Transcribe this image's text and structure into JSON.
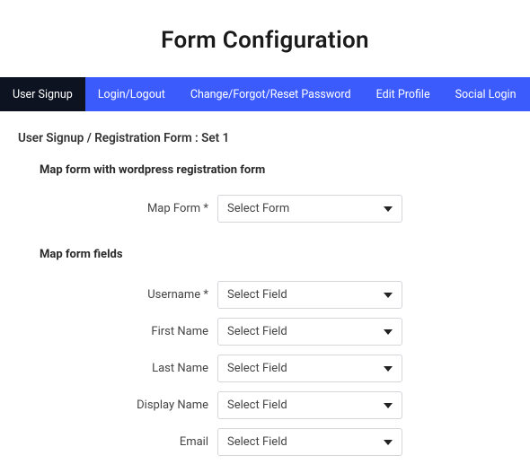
{
  "page_title": "Form Configuration",
  "tabs": [
    {
      "label": "User Signup",
      "active": true
    },
    {
      "label": "Login/Logout",
      "active": false
    },
    {
      "label": "Change/Forgot/Reset Password",
      "active": false
    },
    {
      "label": "Edit Profile",
      "active": false
    },
    {
      "label": "Social Login",
      "active": false
    }
  ],
  "panel": {
    "title": "User Signup / Registration Form : Set 1",
    "section_map_form": "Map form with wordpress registration form",
    "section_map_fields": "Map form fields",
    "map_form_label": "Map Form *",
    "map_form_value": "Select Form",
    "fields": [
      {
        "label": "Username *",
        "value": "Select Field"
      },
      {
        "label": "First Name",
        "value": "Select Field"
      },
      {
        "label": "Last Name",
        "value": "Select Field"
      },
      {
        "label": "Display Name",
        "value": "Select Field"
      },
      {
        "label": "Email",
        "value": "Select Field"
      }
    ]
  }
}
